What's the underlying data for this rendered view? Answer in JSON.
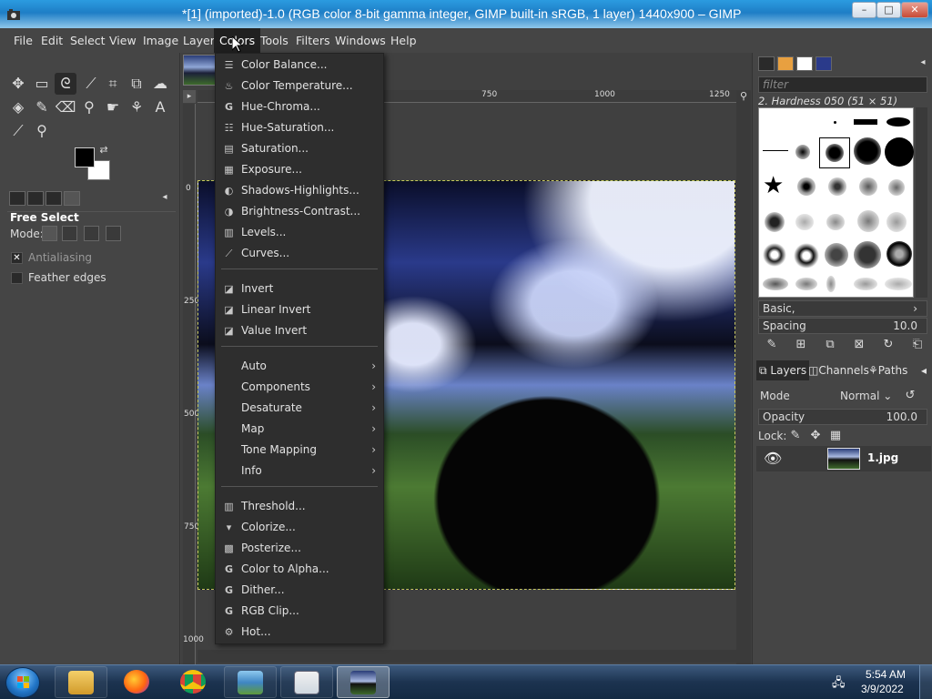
{
  "window": {
    "title": "*[1] (imported)-1.0 (RGB color 8-bit gamma integer, GIMP built-in sRGB, 1 layer) 1440x900 – GIMP",
    "minimize_glyph": "–",
    "maximize_glyph": "□",
    "close_glyph": "✕"
  },
  "menubar": {
    "items": [
      "File",
      "Edit",
      "Select",
      "View",
      "Image",
      "Layer",
      "Colors",
      "Tools",
      "Filters",
      "Windows",
      "Help"
    ],
    "active": "Colors"
  },
  "toolbox": {
    "tool_options_title": "Free Select",
    "mode_label": "Mode:",
    "antialiasing_label": "Antialiasing",
    "antialiasing_checked": true,
    "antialiasing_mark": "✕",
    "feather_label": "Feather edges",
    "feather_checked": false
  },
  "canvas": {
    "ruler_h_ticks": [
      "750",
      "1000",
      "1250"
    ],
    "ruler_v_ticks": [
      "0",
      "250",
      "500",
      "750",
      "1000"
    ]
  },
  "colors_menu": {
    "group1": [
      "Color Balance...",
      "Color Temperature...",
      "Hue-Chroma...",
      "Hue-Saturation...",
      "Saturation...",
      "Exposure...",
      "Shadows-Highlights...",
      "Brightness-Contrast...",
      "Levels...",
      "Curves..."
    ],
    "group2": [
      "Invert",
      "Linear Invert",
      "Value Invert"
    ],
    "group3": [
      "Auto",
      "Components",
      "Desaturate",
      "Map",
      "Tone Mapping",
      "Info"
    ],
    "group4": [
      "Threshold...",
      "Colorize...",
      "Posterize...",
      "Color to Alpha...",
      "Dither...",
      "RGB Clip...",
      "Hot..."
    ],
    "submenu_arrow": "›"
  },
  "brushes": {
    "filter_placeholder": "filter",
    "current_brush": "2. Hardness 050 (51 × 51)",
    "preset": "Basic,",
    "spacing_label": "Spacing",
    "spacing_value": "10.0"
  },
  "layers": {
    "tabs": [
      "Layers",
      "Channels",
      "Paths"
    ],
    "mode_label": "Mode",
    "mode_value": "Normal",
    "opacity_label": "Opacity",
    "opacity_value": "100.0",
    "lock_label": "Lock:",
    "layer_name": "1.jpg"
  },
  "taskbar": {
    "time": "5:54 AM",
    "date": "3/9/2022"
  }
}
